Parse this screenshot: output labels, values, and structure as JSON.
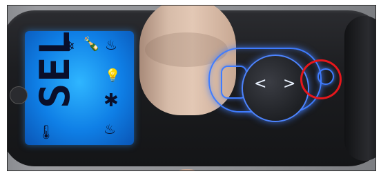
{
  "photo": {
    "lcd_text": "SEL",
    "icons": {
      "snowflake": "❄",
      "bottle": "🍾",
      "flame_tl": "♨",
      "bulb": "💡",
      "asterisk": "✱",
      "flame_bl": "♨",
      "thermometer": "🌡"
    },
    "arrow_left": "<",
    "arrow_right": ">",
    "highlight_color": "#e5171c",
    "accent_color": "#3f7cff"
  }
}
